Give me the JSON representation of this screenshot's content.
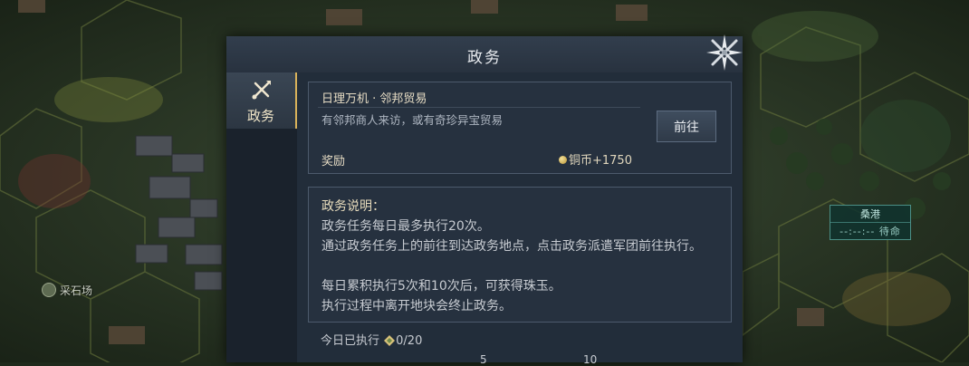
{
  "map": {
    "quarry_label": "采石场",
    "dock_name": "桑港",
    "dock_sub": "--:--:-- 待命"
  },
  "dialog": {
    "title": "政务",
    "tab_label": "政务",
    "task": {
      "title": "日理万机 · 邻邦贸易",
      "description": "有邻邦商人来访，或有奇珍异宝贸易",
      "go_label": "前往",
      "reward_label": "奖励",
      "reward_value": "铜币+1750"
    },
    "info": {
      "heading": "政务说明：",
      "line1": "政务任务每日最多执行20次。",
      "line2": "通过政务任务上的前往到达政务地点，点击政务派遣军团前往执行。",
      "line3": "每日累积执行5次和10次后，可获得珠玉。",
      "line4": "执行过程中离开地块会终止政务。"
    },
    "daily": {
      "label": "今日已执行",
      "count": "0/20",
      "milestones": [
        "5",
        "10"
      ]
    }
  },
  "colors": {
    "accent_gold": "#d9b25a",
    "panel_bg": "#26313f",
    "dock_teal": "#4b8f86"
  }
}
